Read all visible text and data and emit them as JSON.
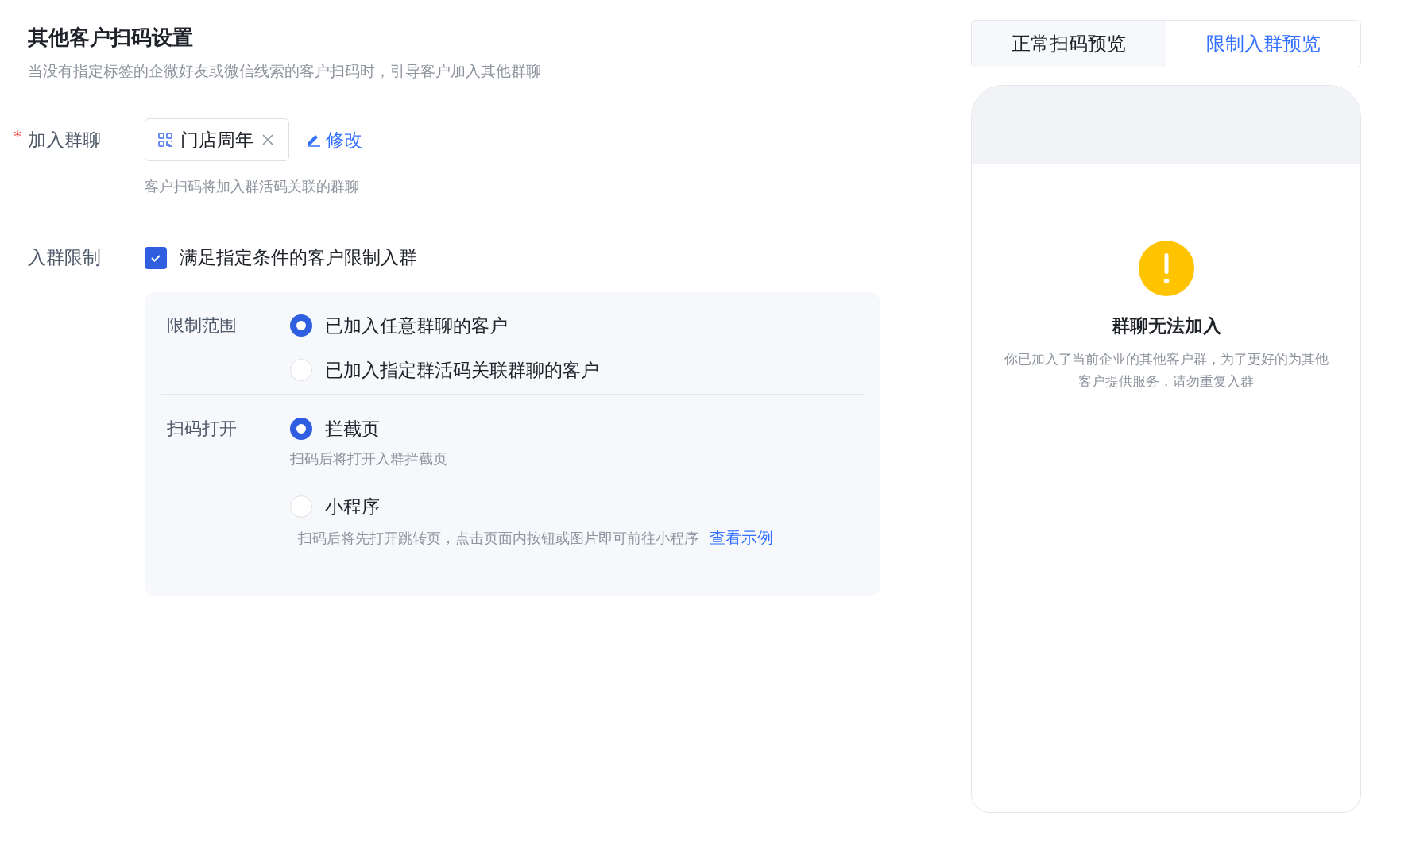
{
  "header": {
    "title": "其他客户扫码设置",
    "description": "当没有指定标签的企微好友或微信线索的客户扫码时，引导客户加入其他群聊"
  },
  "join_group": {
    "label": "加入群聊",
    "required_mark": "*",
    "tag": "门店周年",
    "edit_link": "修改",
    "hint": "客户扫码将加入群活码关联的群聊"
  },
  "restriction": {
    "label": "入群限制",
    "checkbox_label": "满足指定条件的客户限制入群",
    "checked": true,
    "groups": [
      {
        "label": "限制范围",
        "options": [
          {
            "label": "已加入任意群聊的客户",
            "selected": true
          },
          {
            "label": "已加入指定群活码关联群聊的客户",
            "selected": false
          }
        ]
      },
      {
        "label": "扫码打开",
        "options": [
          {
            "label": "拦截页",
            "selected": true,
            "hint": "扫码后将打开入群拦截页"
          },
          {
            "label": "小程序",
            "selected": false,
            "hint": "扫码后将先打开跳转页，点击页面内按钮或图片即可前往小程序",
            "link": "查看示例"
          }
        ]
      }
    ]
  },
  "preview": {
    "tabs": [
      {
        "label": "正常扫码预览",
        "selected": false
      },
      {
        "label": "限制入群预览",
        "selected": true
      }
    ],
    "notice_title": "群聊无法加入",
    "notice_text": "你已加入了当前企业的其他客户群，为了更好的为其他客户提供服务，请勿重复入群"
  }
}
